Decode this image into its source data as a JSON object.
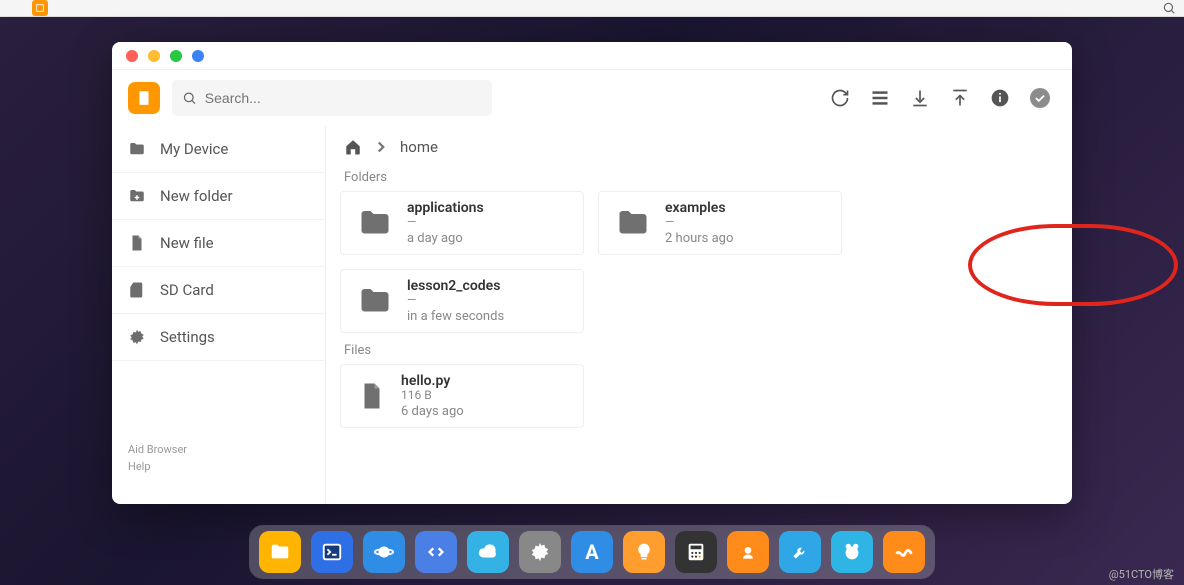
{
  "search": {
    "placeholder": "Search..."
  },
  "breadcrumb": {
    "current": "home"
  },
  "sidebar": {
    "items": [
      {
        "label": "My Device"
      },
      {
        "label": "New folder"
      },
      {
        "label": "New file"
      },
      {
        "label": "SD Card"
      },
      {
        "label": "Settings"
      }
    ],
    "footer_line1": "Aid Browser",
    "footer_line2": "Help"
  },
  "sections": {
    "folders_label": "Folders",
    "files_label": "Files"
  },
  "folders": [
    {
      "name": "applications",
      "size": "—",
      "time": "a day ago"
    },
    {
      "name": "examples",
      "size": "—",
      "time": "2 hours ago"
    },
    {
      "name": "lesson2_codes",
      "size": "—",
      "time": "in a few seconds"
    }
  ],
  "files": [
    {
      "name": "hello.py",
      "size": "116 B",
      "time": "6 days ago"
    }
  ],
  "toolbar_icons": [
    "refresh",
    "list-view",
    "download",
    "upload",
    "info",
    "check"
  ],
  "dock_colors": [
    "#ffb400",
    "#2f6fe6",
    "#2f8de6",
    "#4a7fe6",
    "#34b2e6",
    "#888888",
    "#2f8de6",
    "#ff9e2e",
    "#333333",
    "#ff8c1a",
    "#2fa7e6",
    "#2fb4e6",
    "#ff8c1a"
  ],
  "watermark": "@51CTO博客"
}
